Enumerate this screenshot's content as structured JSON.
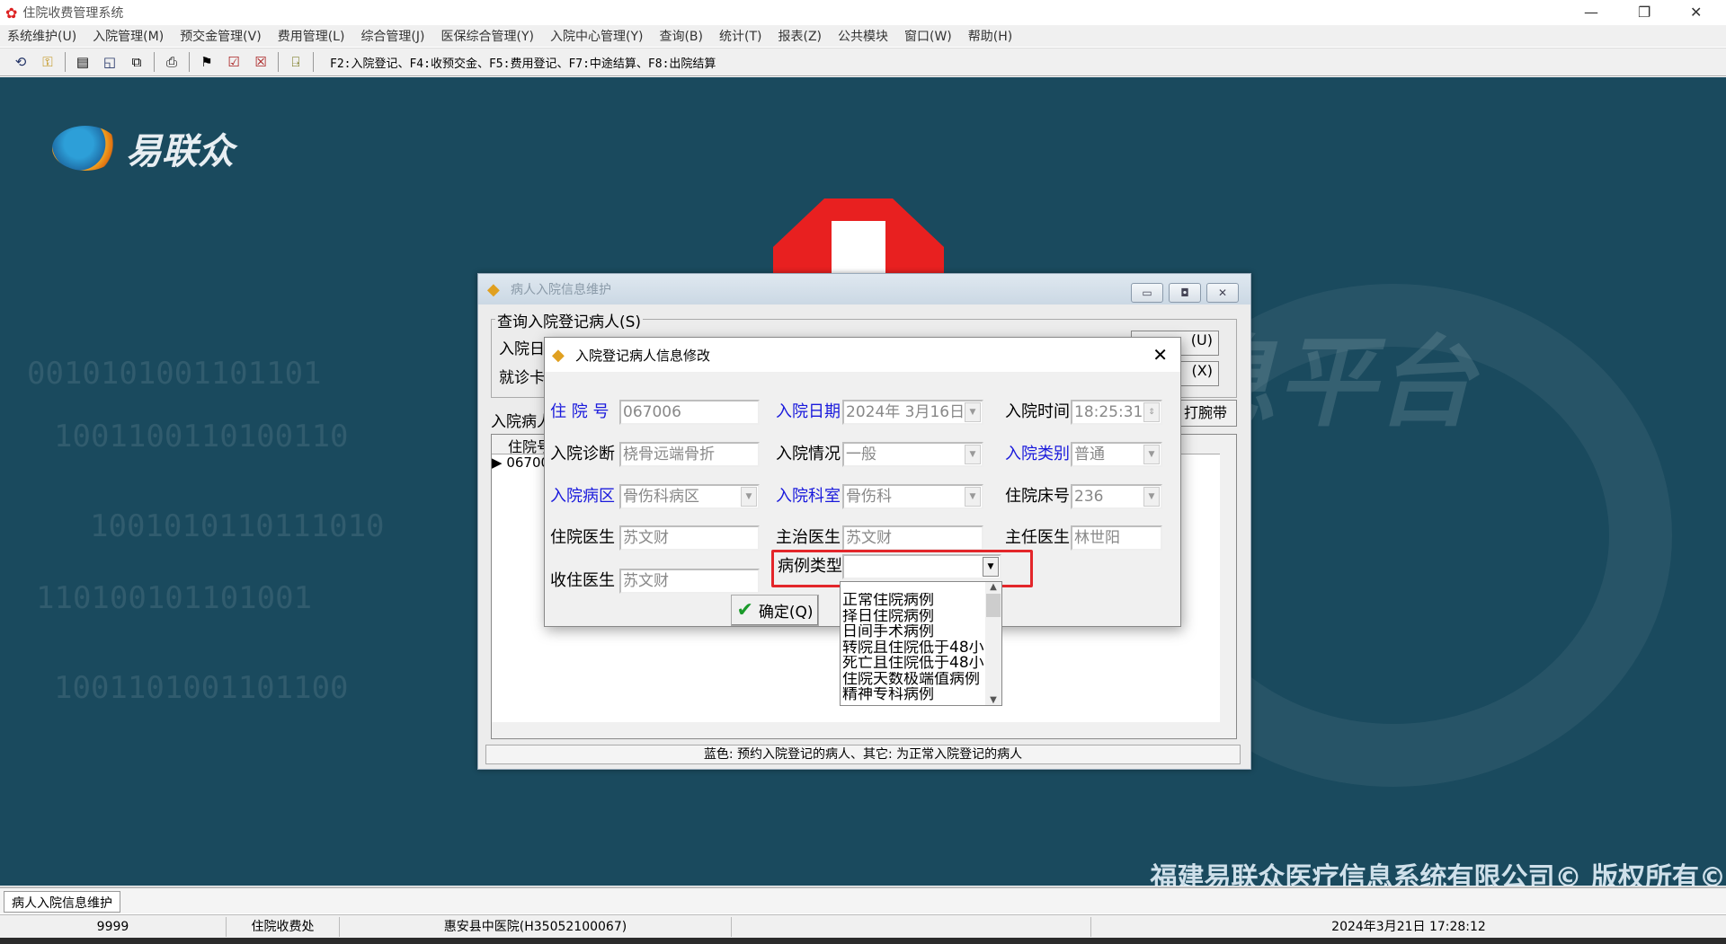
{
  "window": {
    "title": "住院收费管理系统",
    "app_icon": "app-logo-icon",
    "controls": [
      "minimize",
      "restore",
      "close"
    ]
  },
  "menu": [
    "系统维护(U)",
    "入院管理(M)",
    "预交金管理(V)",
    "费用管理(L)",
    "综合管理(J)",
    "医保综合管理(Y)",
    "入院中心管理(Y)",
    "查询(B)",
    "统计(T)",
    "报表(Z)",
    "公共模块",
    "窗口(W)",
    "帮助(H)"
  ],
  "toolbar": {
    "hotkeys": "F2:入院登记、F4:收预交金、F5:费用登记、F7:中途结算、F8:出院结算"
  },
  "desktop": {
    "brand": "易联众",
    "copyright": "福建易联众医疗信息系统有限公司© 版权所有©",
    "watermark": "息平台"
  },
  "outer_dialog": {
    "title": "病人入院信息维护",
    "group_label": "查询入院登记病人(S)",
    "row1_label": "入院日",
    "row2_label": "就诊卡",
    "list_label": "入院病人",
    "grid_header": "住院号",
    "grid_row": "06700",
    "btn_u": "(U)",
    "btn_x": "(X)",
    "wristband_btn": "打腕带",
    "status": "蓝色: 预约入院登记的病人、其它: 为正常入院登记的病人"
  },
  "inner_dialog": {
    "title": "入院登记病人信息修改",
    "fields": {
      "zyh": {
        "label": "住 院 号",
        "value": "067006"
      },
      "rydate": {
        "label": "入院日期",
        "value": "2024年 3月16日"
      },
      "rytime": {
        "label": "入院时间",
        "value": "18:25:31"
      },
      "ryzd": {
        "label": "入院诊断",
        "value": "桡骨远端骨折"
      },
      "ryqk": {
        "label": "入院情况",
        "value": "一般"
      },
      "rylb": {
        "label": "入院类别",
        "value": "普通"
      },
      "rybq": {
        "label": "入院病区",
        "value": "骨伤科病区"
      },
      "ryks": {
        "label": "入院科室",
        "value": "骨伤科"
      },
      "zycw": {
        "label": "住院床号",
        "value": "236"
      },
      "zyys": {
        "label": "住院医生",
        "value": "苏文财"
      },
      "zzys": {
        "label": "主治医生",
        "value": "苏文财"
      },
      "zrys": {
        "label": "主任医生",
        "value": "林世阳"
      },
      "szys": {
        "label": "收住医生",
        "value": "苏文财"
      },
      "bllx": {
        "label": "病例类型",
        "value": ""
      }
    },
    "case_type_options": [
      "正常住院病例",
      "择日住院病例",
      "日间手术病例",
      "转院且住院低于48小",
      "死亡且住院低于48小",
      "住院天数极端值病例",
      "精神专科病例"
    ],
    "confirm_label": "确定(Q)",
    "highlight_color": "#e3262a"
  },
  "tabs": [
    "病人入院信息维护"
  ],
  "status": {
    "user": "9999",
    "dept": "住院收费处",
    "hospital": "惠安县中医院(H35052100067)",
    "empty": "",
    "datetime": "2024年3月21日 17:28:12"
  }
}
